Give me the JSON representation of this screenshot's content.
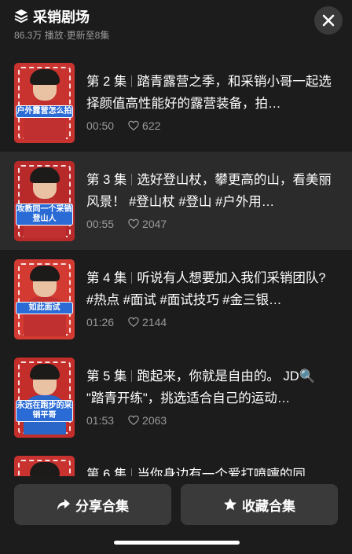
{
  "header": {
    "title": "采销剧场",
    "subtitle": "86.3万 播放·更新至8集",
    "icon": "layers-icon"
  },
  "episodes": [
    {
      "label": "第 2 集",
      "title": "踏青露营之季，和采销小哥一起选择颜值高性能好的露营装备，拍…",
      "duration": "00:50",
      "likes": "622",
      "thumb_caption": "户外露营怎么拍",
      "thumb_bg": "#c8332f",
      "active": false
    },
    {
      "label": "第 3 集",
      "title": "选好登山杖，攀更高的山，看美丽风景！ #登山杖 #登山 #户外用…",
      "duration": "00:55",
      "likes": "2047",
      "thumb_caption": "攻教同一个采销登山人",
      "thumb_bg": "#b82a2a",
      "active": true
    },
    {
      "label": "第 4 集",
      "title": "听说有人想要加入我们采销团队? #热点 #面试 #面试技巧 #金三银…",
      "duration": "01:26",
      "likes": "2144",
      "thumb_caption": "如此面试",
      "thumb_bg": "#d23a32",
      "active": false
    },
    {
      "label": "第 5 集",
      "title": "跑起来，你就是自由的。 JD🔍 \"踏青开练\"，挑选适合自己的运动…",
      "duration": "01:53",
      "likes": "2063",
      "thumb_caption": "永远在跑步的采销平哥",
      "thumb_bg": "#c32e2a",
      "active": false
    },
    {
      "label": "第 6 集",
      "title": "当你身边有一个爱打喷嚏的同",
      "duration": "",
      "likes": "",
      "thumb_caption": "",
      "thumb_bg": "#c8332f",
      "active": false
    }
  ],
  "actions": {
    "share_label": "分享合集",
    "collect_label": "收藏合集"
  },
  "colors": {
    "background": "#1c1c1c",
    "active_row": "#2b2b2b",
    "button": "#3a3a3a",
    "muted_text": "#9a9a9a"
  }
}
